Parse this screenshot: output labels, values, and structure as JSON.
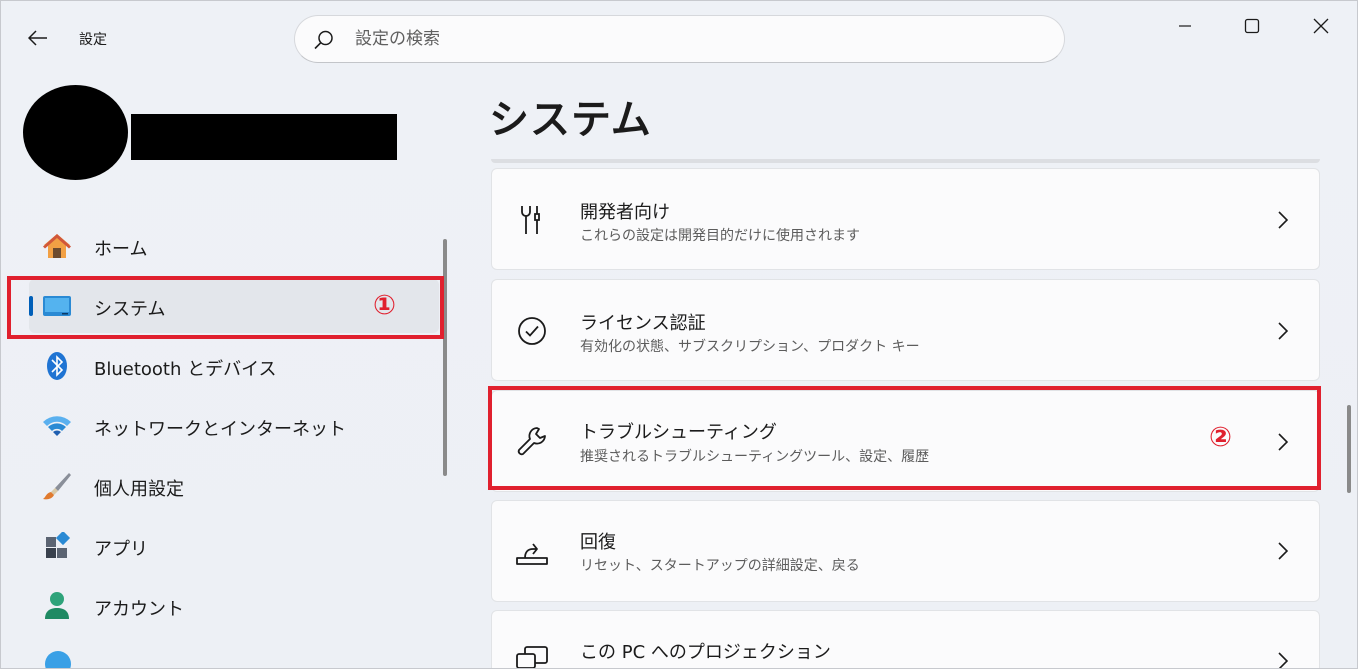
{
  "window": {
    "app_title": "設定",
    "search_placeholder": "設定の検索"
  },
  "sidebar": {
    "items": [
      {
        "label": "ホーム",
        "icon": "home-icon"
      },
      {
        "label": "システム",
        "icon": "monitor-icon",
        "selected": true
      },
      {
        "label": "Bluetooth とデバイス",
        "icon": "bluetooth-icon"
      },
      {
        "label": "ネットワークとインターネット",
        "icon": "wifi-icon"
      },
      {
        "label": "個人用設定",
        "icon": "paintbrush-icon"
      },
      {
        "label": "アプリ",
        "icon": "apps-icon"
      },
      {
        "label": "アカウント",
        "icon": "person-icon"
      }
    ]
  },
  "main": {
    "title": "システム",
    "cards": [
      {
        "title": "開発者向け",
        "subtitle": "これらの設定は開発目的だけに使用されます",
        "icon": "developer-tools-icon"
      },
      {
        "title": "ライセンス認証",
        "subtitle": "有効化の状態、サブスクリプション、プロダクト キー",
        "icon": "check-circle-icon"
      },
      {
        "title": "トラブルシューティング",
        "subtitle": "推奨されるトラブルシューティングツール、設定、履歴",
        "icon": "wrench-icon"
      },
      {
        "title": "回復",
        "subtitle": "リセット、スタートアップの詳細設定、戻る",
        "icon": "recovery-icon"
      },
      {
        "title": "この PC へのプロジェクション",
        "subtitle": "",
        "icon": "projection-icon"
      }
    ]
  },
  "annotations": {
    "step1": "①",
    "step2": "②",
    "highlight_color": "#e0202e"
  },
  "colors": {
    "accent": "#005fb8"
  }
}
